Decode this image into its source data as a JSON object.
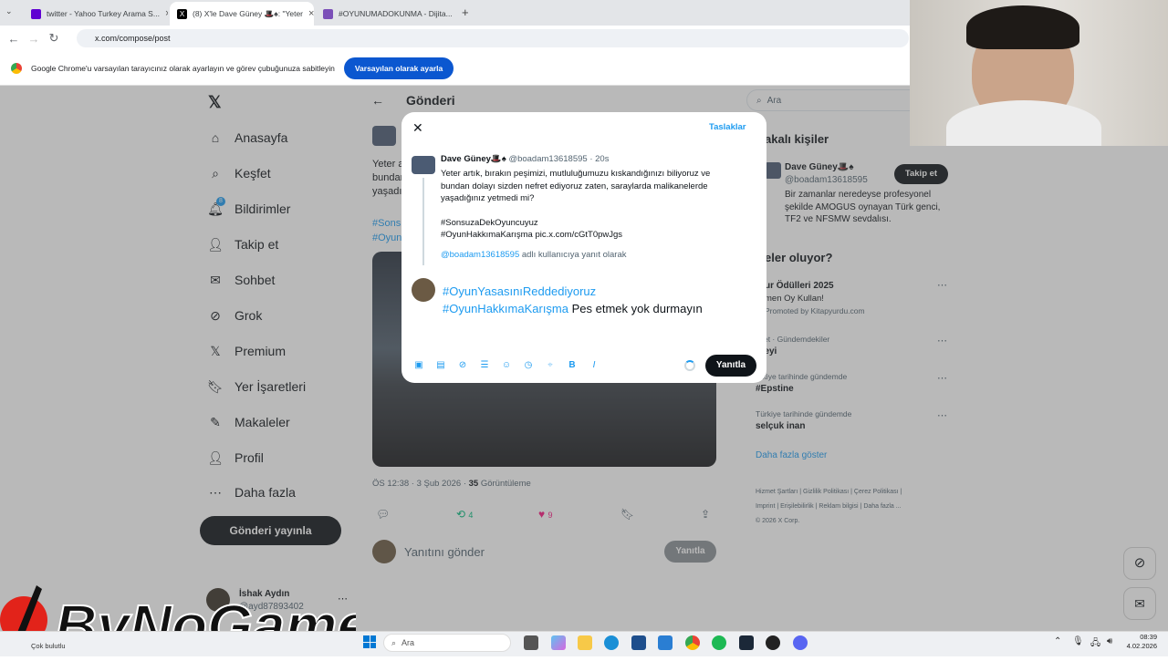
{
  "browser": {
    "tabs": [
      {
        "title": "twitter - Yahoo Turkey Arama S...",
        "color": "#6001d2"
      },
      {
        "title": "(8) X'le Dave Güney 🎩♠: \"Yeter",
        "color": "#000000"
      },
      {
        "title": "#OYUNUMADOKUNMA - Dijita...",
        "color": "#7b4fb8"
      }
    ],
    "url": "x.com/compose/post",
    "infobar_text": "Google Chrome'u varsayılan tarayıcınız olarak ayarlayın ve görev çubuğunuza sabitleyin",
    "infobar_button": "Varsayılan olarak ayarla"
  },
  "sidebar": {
    "items": [
      {
        "label": "Anasayfa",
        "icon": "home-icon"
      },
      {
        "label": "Keşfet",
        "icon": "search-icon"
      },
      {
        "label": "Bildirimler",
        "icon": "bell-icon"
      },
      {
        "label": "Takip et",
        "icon": "follow-icon"
      },
      {
        "label": "Sohbet",
        "icon": "mail-icon"
      },
      {
        "label": "Grok",
        "icon": "grok-icon"
      },
      {
        "label": "Premium",
        "icon": "x-icon"
      },
      {
        "label": "Yer İşaretleri",
        "icon": "bookmark-icon"
      },
      {
        "label": "Makaleler",
        "icon": "article-icon"
      },
      {
        "label": "Profil",
        "icon": "profile-icon"
      },
      {
        "label": "Daha fazla",
        "icon": "more-icon"
      }
    ],
    "notification_badge": "8",
    "post_button": "Gönderi yayınla",
    "user_name": "İshak Aydın",
    "user_handle": "@ayd87893402"
  },
  "main": {
    "header": "Gönderi",
    "tweet_text_fragments": [
      "Yeter a",
      "bundan",
      "yaşadı"
    ],
    "hashtag_fragments": [
      "#Sons",
      "#Oyun"
    ],
    "timestamp": "ÖS 12:38 · 3 Şub 2026 · ",
    "views_count": "35",
    "views_label": " Görüntüleme",
    "retweets": "4",
    "likes": "9",
    "reply_placeholder": "Yanıtını gönder",
    "reply_button": "Yanıtla"
  },
  "right": {
    "search_placeholder": "Ara",
    "relevant_title": "akalı kişiler",
    "person_name": "Dave Güney🎩♠",
    "person_handle": "@boadam13618595",
    "person_bio": "Bir zamanlar neredeyse profesyonel şekilde AMOGUS oynayan Türk genci, TF2 ve NFSMW sevdalısı.",
    "follow_button": "Takip et",
    "trends_title": "eler oluyor?",
    "trends": [
      {
        "context": "",
        "title": "ur Ödülleri 2025",
        "sub": "men Oy Kullan!",
        "promo": "Promoted by Kitapyurdu.com"
      },
      {
        "context": "aset · Gündemdekiler",
        "title": "nteyi",
        "sub": "",
        "promo": ""
      },
      {
        "context": "ürkiye tarihinde gündemde",
        "title": "#Epstine",
        "sub": "",
        "promo": ""
      },
      {
        "context": "Türkiye tarihinde gündemde",
        "title": "selçuk inan",
        "sub": "",
        "promo": ""
      }
    ],
    "show_more": "Daha fazla göster",
    "footer_links": [
      "Hizmet Şartları",
      "Gizlilik Politikası",
      "Çerez Politikası",
      "Imprint",
      "Erişilebilirlik",
      "Reklam bilgisi",
      "Daha fazla ..."
    ],
    "copyright": "© 2026 X Corp."
  },
  "modal": {
    "drafts": "Taslaklar",
    "author_name": "Dave Güney🎩♠",
    "author_handle": "@boadam13618595 · 20s",
    "text_line1": "Yeter artık, bırakın peşimizi, mutluluğumuzu kıskandığınızı biliyoruz ve",
    "text_line2": "bundan dolayı sizden nefret ediyoruz zaten, saraylarda malikanelerde",
    "text_line3": "yaşadığınız yetmedi mi?",
    "hashtag1": "#SonsuzaDekOyuncuyuz",
    "hashtag2": "#OyunHakkımaKarışma pic.x.com/cGtT0pwJgs",
    "reply_to_handle": "@boadam13618595",
    "reply_to_suffix": " adlı kullanıcıya yanıt olarak",
    "compose_tag1": "#OyunYasasınıReddediyoruz",
    "compose_tag2": "#OyunHakkımaKarışma",
    "compose_text": " Pes etmek yok durmayın",
    "submit": "Yanıtla"
  },
  "taskbar": {
    "search": "Ara",
    "time": "08:39",
    "date": "4.02.2026",
    "status_text": "Çok bulutlu"
  },
  "watermark": "ByNoGame",
  "colors": {
    "accent": "#1d9bf0",
    "dark": "#0f1419",
    "like": "#f91880",
    "retweet": "#00ba7c"
  }
}
